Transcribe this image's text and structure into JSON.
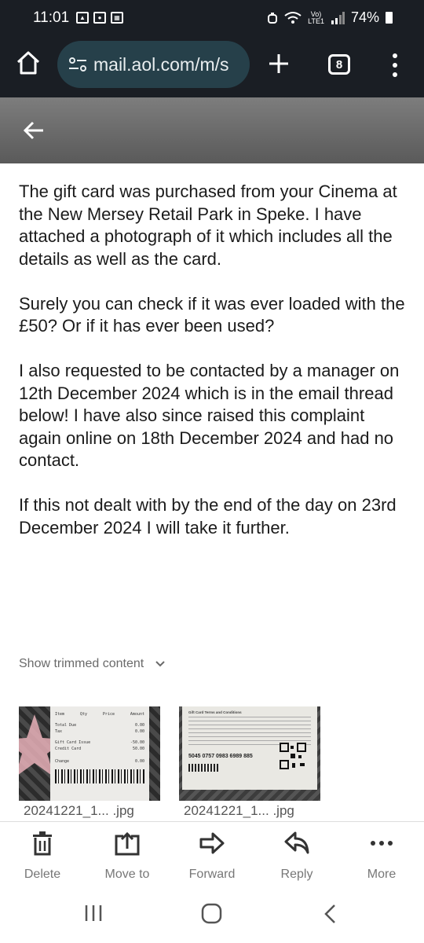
{
  "status": {
    "time": "11:01",
    "battery": "74%",
    "volte": "Vo)\nLTE1",
    "icons": [
      "image-icon",
      "circle-notification-icon",
      "qr-notification-icon",
      "alarm-icon",
      "wifi-icon",
      "signal-icon",
      "battery-icon"
    ]
  },
  "browser": {
    "url": "mail.aol.com/m/s",
    "tab_count": "8"
  },
  "email": {
    "paragraphs": [
      "The gift card was purchased from your Cinema at the New Mersey Retail Park in Speke. I have attached a photograph of it which includes all the details as well as the card.",
      "Surely you can check if it was ever loaded with the £50? Or if it has ever been used?",
      "I also requested to be contacted by a manager on 12th December 2024 which is in the email thread below! I have also since raised this complaint again online on 18th December 2024 and had no contact.",
      "If this not dealt with by the end of the day on 23rd December 2024 I will take it further."
    ],
    "show_trimmed": "Show trimmed content"
  },
  "attachments": [
    {
      "name": "20241221_1... .jpg",
      "receipt_lines": [
        "Item",
        "Qty",
        "Price",
        "Amount",
        "Total Due",
        "Tax",
        "0.00",
        "0.00",
        "Gift Card Issue",
        "Credit Card",
        "-50.00",
        "50.00",
        "Change",
        "0.00"
      ]
    },
    {
      "name": "20241221_1... .jpg",
      "card_number": "5045 0757 0983 6989 885",
      "card_heading": "Gift Card Terms and Conditions"
    }
  ],
  "actions": [
    {
      "label": "Delete",
      "icon": "trash-icon"
    },
    {
      "label": "Move to",
      "icon": "move-to-icon"
    },
    {
      "label": "Forward",
      "icon": "forward-icon"
    },
    {
      "label": "Reply",
      "icon": "reply-icon"
    },
    {
      "label": "More",
      "icon": "more-icon"
    }
  ],
  "colors": {
    "statusbar": "#1a1e24",
    "urlbar": "#26404a",
    "header_gray": "#6e6e6e",
    "text": "#1b1b1b"
  }
}
